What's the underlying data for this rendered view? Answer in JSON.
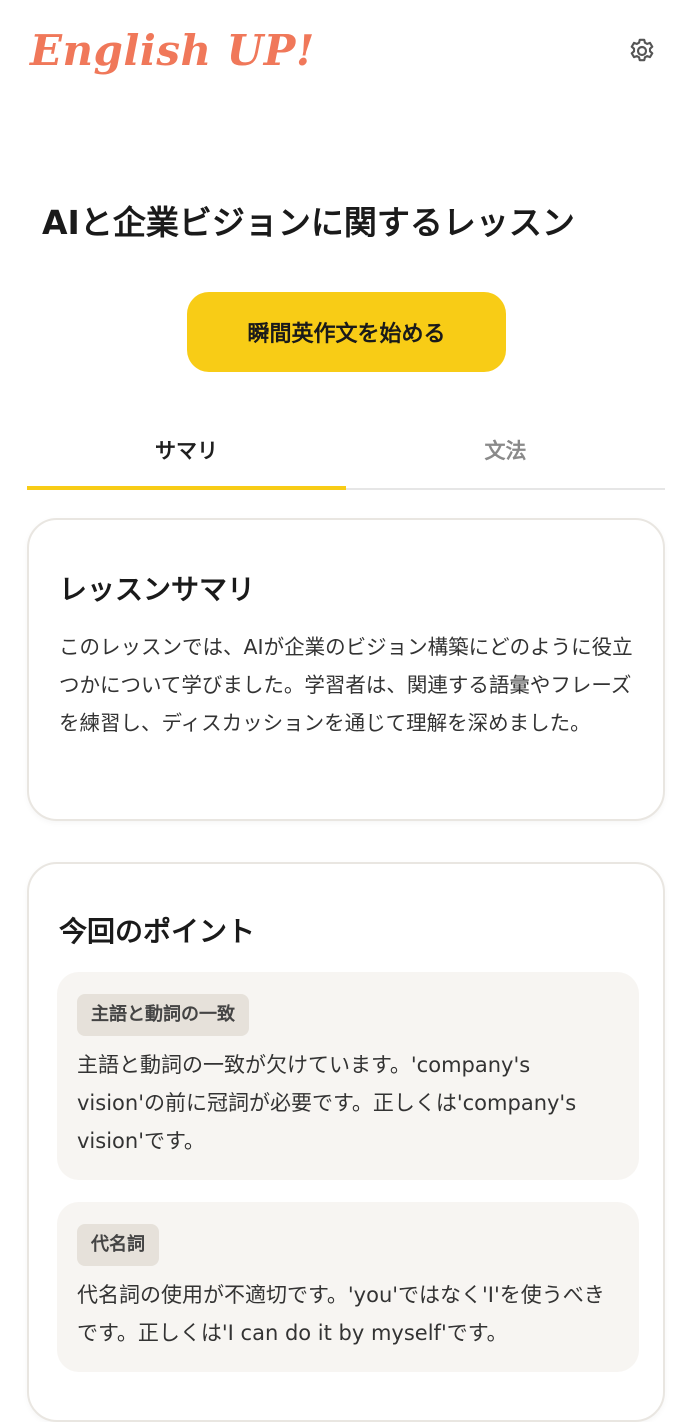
{
  "app": {
    "logo": "English UP!"
  },
  "header": {
    "settings_icon": "gear-icon"
  },
  "lesson": {
    "title": "AIと企業ビジョンに関するレッスン",
    "start_button": "瞬間英作文を始める"
  },
  "tabs": [
    {
      "label": "サマリ",
      "active": true
    },
    {
      "label": "文法",
      "active": false
    }
  ],
  "summary": {
    "heading": "レッスンサマリ",
    "text": "このレッスンでは、AIが企業のビジョン構築にどのように役立つかについて学びました。学習者は、関連する語彙やフレーズを練習し、ディスカッションを通じて理解を深めました。"
  },
  "points": {
    "heading": "今回のポイント",
    "items": [
      {
        "tag": "主語と動詞の一致",
        "text": "主語と動詞の一致が欠けています。'company's vision'の前に冠詞が必要です。正しくは'company's vision'です。"
      },
      {
        "tag": "代名詞",
        "text": "代名詞の使用が不適切です。'you'ではなく'I'を使うべきです。正しくは'I can do it by myself'です。"
      }
    ]
  },
  "colors": {
    "logo": "#f0785a",
    "accent": "#f8cc16",
    "point_bg": "#f7f5f2",
    "tag_bg": "#e6e1da"
  }
}
